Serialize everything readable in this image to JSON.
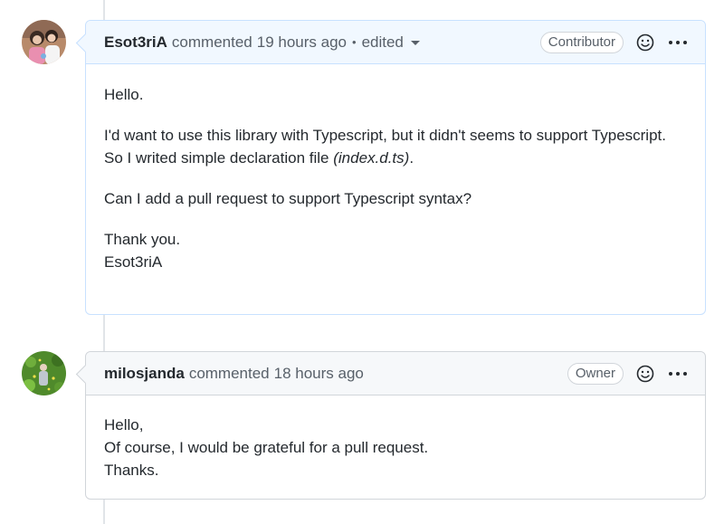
{
  "comments": [
    {
      "author": "Esot3riA",
      "action": "commented",
      "timestamp": "19 hours ago",
      "separator": "•",
      "edited_label": "edited",
      "role_label": "Contributor",
      "avatar_icon": "user-avatar-photo",
      "body": {
        "p1": "Hello.",
        "p2_line1": "I'd want to use this library with Typescript, but it didn't seems to support Typescript.",
        "p2_line2_prefix": "So I writed simple declaration file ",
        "p2_line2_em": "(index.d.ts)",
        "p2_line2_suffix": ".",
        "p3": "Can I add a pull request to support Typescript syntax?",
        "p4_line1": "Thank you.",
        "p4_line2": "Esot3riA"
      }
    },
    {
      "author": "milosjanda",
      "action": "commented",
      "timestamp": "18 hours ago",
      "role_label": "Owner",
      "avatar_icon": "user-avatar-photo",
      "body": {
        "line1": "Hello,",
        "line2": "Of course, I would be grateful for a pull request.",
        "line3": "Thanks."
      }
    }
  ],
  "colors": {
    "highlight_header": "#f1f8ff",
    "highlight_border": "#c8e1ff",
    "header_bg": "#f6f8fa",
    "border": "#d1d5da",
    "muted_text": "#586069"
  }
}
